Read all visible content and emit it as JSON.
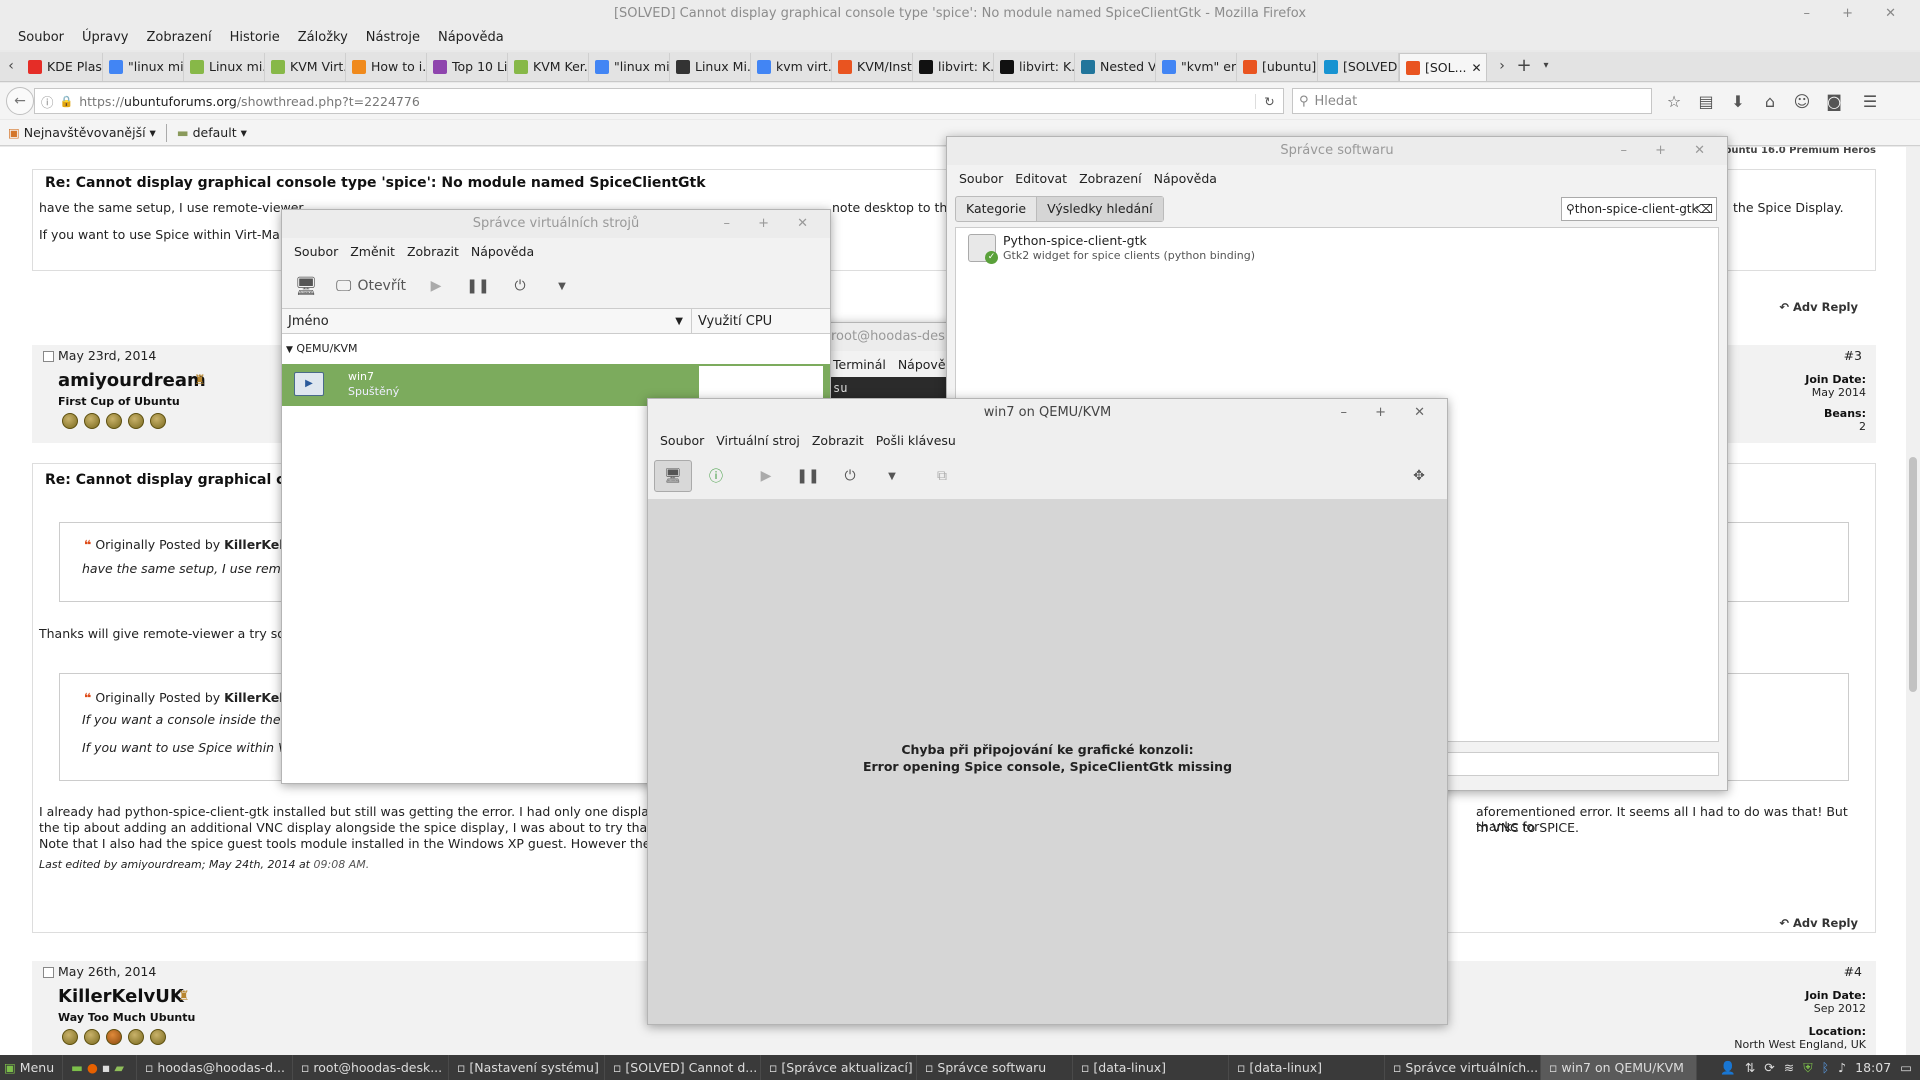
{
  "window": {
    "title": "[SOLVED] Cannot display graphical console type 'spice': No module named SpiceClientGtk - Mozilla Firefox",
    "controls": "– + ✕"
  },
  "menubar": [
    "Soubor",
    "Úpravy",
    "Zobrazení",
    "Historie",
    "Záložky",
    "Nástroje",
    "Nápověda"
  ],
  "tabs": [
    {
      "label": "KDE Plas...",
      "color": "#e52d27"
    },
    {
      "label": "\"linux mi...",
      "color": "#4285f4"
    },
    {
      "label": "Linux mi...",
      "color": "#87b848"
    },
    {
      "label": "KVM Virt...",
      "color": "#87b848"
    },
    {
      "label": "How to i...",
      "color": "#f08a1c"
    },
    {
      "label": "Top 10 Li...",
      "color": "#8e44ad"
    },
    {
      "label": "KVM Ker...",
      "color": "#87b848"
    },
    {
      "label": "\"linux mi...",
      "color": "#4285f4"
    },
    {
      "label": "Linux Mi...",
      "color": "#333333"
    },
    {
      "label": "kvm virt...",
      "color": "#4285f4"
    },
    {
      "label": "KVM/Inst...",
      "color": "#e95420"
    },
    {
      "label": "libvirt: K...",
      "color": "#111111"
    },
    {
      "label": "libvirt: K...",
      "color": "#111111"
    },
    {
      "label": "Nested V...",
      "color": "#21759b"
    },
    {
      "label": "\"kvm\" er...",
      "color": "#4285f4"
    },
    {
      "label": "[ubuntu] ...",
      "color": "#e95420"
    },
    {
      "label": "[SOLVED...",
      "color": "#1793d1"
    },
    {
      "label": "[SOL...",
      "color": "#e95420"
    }
  ],
  "nav": {
    "url_prefix": "https://",
    "url_domain": "ubuntuforums.org",
    "url_path": "/showthread.php?t=2224776",
    "search_placeholder": "Hledat"
  },
  "bookmarks": {
    "most_visited": "Nejnavštěvovanější",
    "default": "default"
  },
  "forum": {
    "top_right_cut": "Ubuntu 16.0 Premium Heros",
    "post2": {
      "title": "Re: Cannot display graphical console type 'spice': No module named SpiceClientGtk",
      "line1a": "have the same setup, I use remote-viewer",
      "line1b": "note desktop to the",
      "line1c": "the Spice Display.",
      "line2": "If you want to use Spice within Virt-Manag",
      "reply": "Adv Reply"
    },
    "post3": {
      "date": "May 23rd, 2014",
      "number": "#3",
      "user": "amiyourdream",
      "rank": "First Cup of Ubuntu",
      "join_label": "Join Date:",
      "join": "May 2014",
      "beans_label": "Beans:",
      "beans": "2",
      "title": "Re: Cannot display graphical console",
      "quote1_prefix": "Originally Posted by",
      "quote1_author": "KillerKelvUK",
      "quote1_text": "have the same setup, I use remote-",
      "thanks": "Thanks will give remote-viewer a try som",
      "quote2_prefix": "Originally Posted by",
      "quote2_author": "KillerKelvUK",
      "quote2_line1": "If you want a console inside the Vir",
      "quote2_line2": "If you want to use Spice within Virt-",
      "body1a": "I already had python-spice-client-gtk installed but still was getting the error. I had only one display type",
      "body1b": "aforementioned error. It seems all I had to do was that! But thanks for",
      "body2a": "the tip about adding an additional VNC display alongside the spice display, I was about to try that befor",
      "body2b": "m VNC to SPICE.",
      "body3": "Note that I also had the spice guest tools module installed in the Windows XP guest. However the error",
      "edited_prefix": "Last edited by amiyourdream; May 24th, 2014 at",
      "edited_time": "09:08 AM.",
      "reply": "Adv Reply"
    },
    "post4": {
      "date": "May 26th, 2014",
      "number": "#4",
      "user": "KillerKelvUK",
      "rank": "Way Too Much Ubuntu",
      "join_label": "Join Date:",
      "join": "Sep 2012",
      "location_label": "Location:",
      "location": "North West England, UK"
    }
  },
  "virtmanager": {
    "title": "Správce virtuálních strojů",
    "menu": [
      "Soubor",
      "Změnit",
      "Zobrazit",
      "Nápověda"
    ],
    "open_label": "Otevřít",
    "col_name": "Jméno",
    "col_cpu": "Využití CPU",
    "group": "QEMU/KVM",
    "vm_name": "win7",
    "vm_state": "Spuštěný"
  },
  "terminal": {
    "title": "root@hoodas-desk",
    "menu": [
      "Terminál",
      "Nápově"
    ],
    "text": "su"
  },
  "software": {
    "title": "Správce softwaru",
    "menu": [
      "Soubor",
      "Editovat",
      "Zobrazení",
      "Nápověda"
    ],
    "crumb1": "Kategorie",
    "crumb2": "Výsledky hledání",
    "search_value": "thon-spice-client-gtk",
    "result_name": "Python-spice-client-gtk",
    "result_desc": "Gtk2 widget for spice clients (python binding)"
  },
  "vmconsole": {
    "title": "win7 on QEMU/KVM",
    "menu": [
      "Soubor",
      "Virtuální stroj",
      "Zobrazit",
      "Pošli klávesu"
    ],
    "error1": "Chyba při připojování ke grafické konzoli:",
    "error2": "Error opening Spice console, SpiceClientGtk missing"
  },
  "taskbar": {
    "menu": "Menu",
    "items": [
      "hoodas@hoodas-d...",
      "root@hoodas-desk...",
      "[Nastavení systému]",
      "[SOLVED] Cannot d...",
      "[Správce aktualizací]",
      "Správce softwaru",
      "[data-linux]",
      "[data-linux]",
      "Správce virtuálních...",
      "win7 on QEMU/KVM"
    ],
    "clock": "18:07"
  },
  "colors": {
    "vm_selected": "#7cab5d",
    "taskbar": "#3a3a3a"
  }
}
